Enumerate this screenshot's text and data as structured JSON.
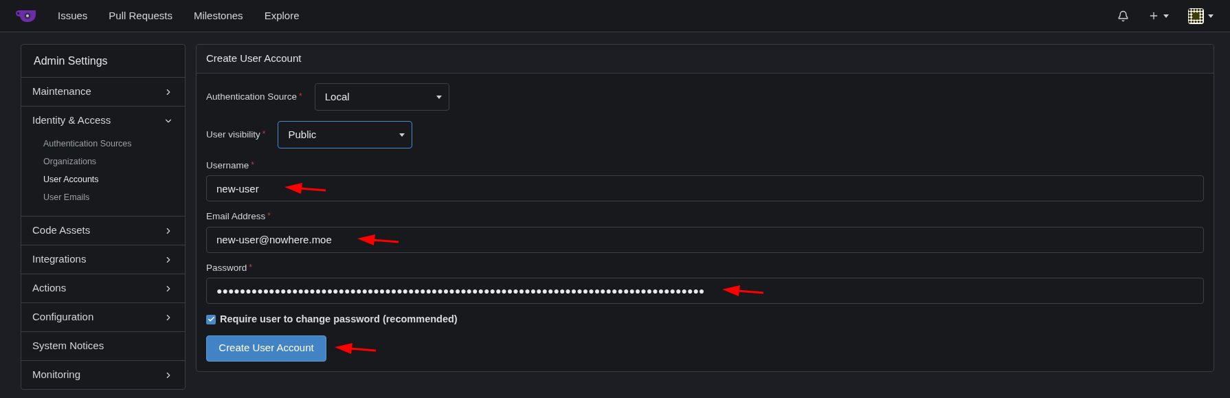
{
  "navbar": {
    "links": [
      "Issues",
      "Pull Requests",
      "Milestones",
      "Explore"
    ]
  },
  "sidebar": {
    "title": "Admin Settings",
    "items": [
      {
        "label": "Maintenance",
        "kind": "group",
        "expanded": false
      },
      {
        "label": "Identity & Access",
        "kind": "group",
        "expanded": true,
        "children": [
          {
            "label": "Authentication Sources",
            "selected": false
          },
          {
            "label": "Organizations",
            "selected": false
          },
          {
            "label": "User Accounts",
            "selected": true
          },
          {
            "label": "User Emails",
            "selected": false
          }
        ]
      },
      {
        "label": "Code Assets",
        "kind": "group",
        "expanded": false
      },
      {
        "label": "Integrations",
        "kind": "group",
        "expanded": false
      },
      {
        "label": "Actions",
        "kind": "group",
        "expanded": false
      },
      {
        "label": "Configuration",
        "kind": "group",
        "expanded": false
      },
      {
        "label": "System Notices",
        "kind": "link"
      },
      {
        "label": "Monitoring",
        "kind": "group",
        "expanded": false
      }
    ]
  },
  "form": {
    "title": "Create User Account",
    "fields": [
      {
        "kind": "select",
        "label": "Authentication Source",
        "required_mark": "*",
        "value": "Local",
        "focused": false
      },
      {
        "kind": "select",
        "label": "User visibility",
        "required_mark": "*",
        "value": "Public",
        "focused": true
      },
      {
        "kind": "text",
        "label": "Username",
        "required_mark": "*",
        "value": "new-user",
        "focused": false,
        "annotated": true
      },
      {
        "kind": "text",
        "label": "Email Address",
        "required_mark": "*",
        "value": "new-user@nowhere.moe",
        "focused": false,
        "annotated": true
      },
      {
        "kind": "password",
        "label": "Password",
        "required_mark": "*",
        "value": "●●●●●●●●●●●●●●●●●●●●●●●●●●●●●●●●●●●●●●●●●●●●●●●●●●●●●●●●●●●●●●●●●●●●●●●●●●●●●●●●●●●●",
        "focused": false,
        "annotated": true
      }
    ],
    "checkbox": {
      "label": "Require user to change password (recommended)",
      "checked": true
    },
    "submit": {
      "label": "Create User Account",
      "annotated": true
    }
  }
}
